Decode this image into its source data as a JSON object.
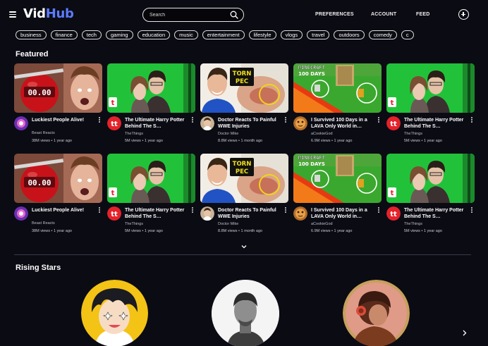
{
  "header": {
    "logo_part1": "Vid",
    "logo_part2": "Hub",
    "search_placeholder": "Search",
    "nav": [
      "PREFERENCES",
      "ACCOUNT",
      "FEED"
    ]
  },
  "categories": [
    "business",
    "finance",
    "tech",
    "gaming",
    "education",
    "music",
    "entertainment",
    "lifestyle",
    "vlogs",
    "travel",
    "outdoors",
    "comedy",
    "c"
  ],
  "featured": {
    "title": "Featured",
    "rows": [
      [
        {
          "title": "Luckiest People Alive!",
          "channel": "Beast Reacts",
          "meta": "38M views • 1 year ago",
          "thumb": "apple",
          "avatar": "beast"
        },
        {
          "title": "The Ultimate Harry Potter Behind The S…",
          "channel": "TheThings",
          "meta": "5M views • 1 year ago",
          "thumb": "potter",
          "avatar": "thethings"
        },
        {
          "title": "Doctor Reacts To Painful WWE Injuries",
          "channel": "Doctor Mike",
          "meta": "8.8M views • 1 month ago",
          "thumb": "wwe",
          "avatar": "doctor"
        },
        {
          "title": "I Survived 100 Days in a LAVA Only World in…",
          "channel": "aCookieGod",
          "meta": "6.9M views • 1 year ago",
          "thumb": "minecraft",
          "avatar": "cookie"
        },
        {
          "title": "The Ultimate Harry Potter Behind The S…",
          "channel": "TheThings",
          "meta": "5M views • 1 year ago",
          "thumb": "potter",
          "avatar": "thethings"
        }
      ],
      [
        {
          "title": "Luckiest People Alive!",
          "channel": "Beast Reacts",
          "meta": "38M views • 1 year ago",
          "thumb": "apple",
          "avatar": "beast"
        },
        {
          "title": "The Ultimate Harry Potter Behind The S…",
          "channel": "TheThings",
          "meta": "5M views • 1 year ago",
          "thumb": "potter",
          "avatar": "thethings"
        },
        {
          "title": "Doctor Reacts To Painful WWE Injuries",
          "channel": "Doctor Mike",
          "meta": "8.8M views • 1 month ago",
          "thumb": "wwe",
          "avatar": "doctor"
        },
        {
          "title": "I Survived 100 Days in a LAVA Only World in…",
          "channel": "aCookieGod",
          "meta": "6.9M views • 1 year ago",
          "thumb": "minecraft",
          "avatar": "cookie"
        },
        {
          "title": "The Ultimate Harry Potter Behind The S…",
          "channel": "TheThings",
          "meta": "5M views • 1 year ago",
          "thumb": "potter",
          "avatar": "thethings"
        }
      ]
    ],
    "thumb_text": {
      "apple_timer": "00.00",
      "wwe_badge_1": "TORN",
      "wwe_badge_2": "PEC",
      "mc_logo": "MINECRAFT",
      "mc_days": "100 DAYS"
    }
  },
  "rising": {
    "title": "Rising Stars",
    "creators": [
      "anime-boy",
      "bw-portrait",
      "lofi-girl"
    ]
  },
  "colors": {
    "background": "#0b0b14",
    "accent": "#5b7cff",
    "thethings_red": "#e5222a"
  },
  "icons": [
    "hamburger-icon",
    "search-icon",
    "plus-circle-icon",
    "kebab-icon",
    "chevron-down-icon",
    "chevron-right-icon"
  ]
}
